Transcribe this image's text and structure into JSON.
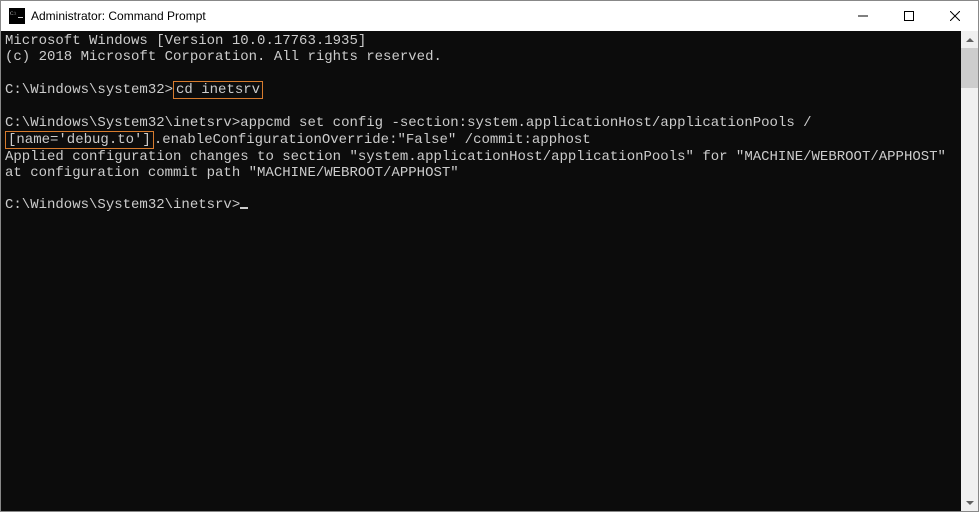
{
  "window": {
    "title": "Administrator: Command Prompt"
  },
  "terminal": {
    "line1": "Microsoft Windows [Version 10.0.17763.1935]",
    "line2": "(c) 2018 Microsoft Corporation. All rights reserved.",
    "prompt1": "C:\\Windows\\system32>",
    "cmd1": "cd inetsrv",
    "prompt2": "C:\\Windows\\System32\\inetsrv>",
    "cmd2_a": "appcmd set config -section:system.applicationHost/applicationPools /",
    "cmd2_highlight": "[name='debug.to']",
    "cmd2_b": ".enableConfigurationOverride:\"False\" /commit:apphost",
    "output1": "Applied configuration changes to section \"system.applicationHost/applicationPools\" for \"MACHINE/WEBROOT/APPHOST\" at configuration commit path \"MACHINE/WEBROOT/APPHOST\"",
    "prompt3": "C:\\Windows\\System32\\inetsrv>"
  }
}
